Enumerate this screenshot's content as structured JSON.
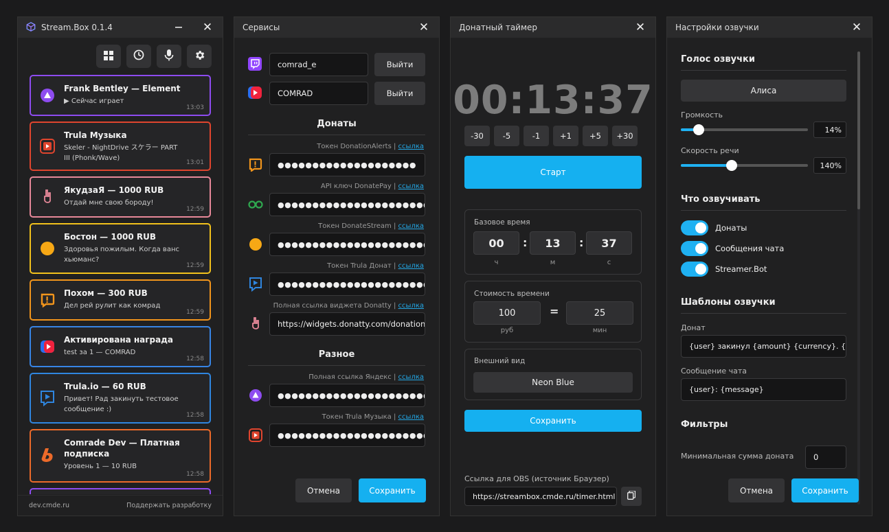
{
  "window1": {
    "title": "Stream.Box 0.1.4",
    "toolbar_icons": [
      "grid-icon",
      "clock-icon",
      "microphone-icon",
      "gear-icon"
    ],
    "cards": [
      {
        "title": "Frank Bentley — Element",
        "subtitle": "▶ Сейчас играет",
        "time": "13:03",
        "color": "#8e4cf0",
        "icon": "alice-icon"
      },
      {
        "title": "Trula Музыка",
        "subtitle": "Skeler - NightDrive スケラー PART III (Phonk/Wave)",
        "time": "13:01",
        "color": "#e0452e",
        "icon": "trula-music-icon"
      },
      {
        "title": "ЯкудзаЯ — 1000 RUB",
        "subtitle": "Отдай мне свою бороду!",
        "time": "12:59",
        "color": "#e8899a",
        "icon": "donatty-icon"
      },
      {
        "title": "Бостон — 1000 RUB",
        "subtitle": "Здоровья пожилым. Когда ванс хьюманс?",
        "time": "12:59",
        "color": "#f3c21c",
        "icon": "donatestream-icon"
      },
      {
        "title": "Похом — 300 RUB",
        "subtitle": "Дел рей рулит как комрад",
        "time": "12:59",
        "color": "#f2951c",
        "icon": "donationalerts-icon"
      },
      {
        "title": "Активирована награда",
        "subtitle": "test за 1 — COMRAD",
        "time": "12:58",
        "color": "#3785e6",
        "icon": "vk-play-icon"
      },
      {
        "title": "Trula.io — 60 RUB",
        "subtitle": "Привет! Рад закинуть тестовое сообщение :)",
        "time": "12:58",
        "color": "#2f86e0",
        "icon": "trula-icon"
      },
      {
        "title": "Comrade Dev — Платная подписка",
        "subtitle": "Уровень 1 — 10 RUB",
        "time": "12:58",
        "color": "#ec6a2a",
        "icon": "boosty-icon"
      }
    ],
    "footer_left": "dev.cmde.ru",
    "footer_right": "Поддержать разработку"
  },
  "window2": {
    "title": "Сервисы",
    "accounts": [
      {
        "icon": "twitch-icon",
        "value": "comrad_e",
        "button": "Выйти"
      },
      {
        "icon": "vk-play-icon",
        "value": "COMRAD",
        "button": "Выйти"
      }
    ],
    "donations_title": "Донаты",
    "tokens": [
      {
        "label": "Токен DonationAlerts",
        "link": "ссылка",
        "value": "●●●●●●●●●●●●●●●●●●●●",
        "icon": "donationalerts-icon"
      },
      {
        "label": "API ключ DonatePay",
        "link": "ссылка",
        "value": "●●●●●●●●●●●●●●●●●●●●●●●●●●●",
        "icon": "donatepay-icon"
      },
      {
        "label": "Токен DonateStream",
        "link": "ссылка",
        "value": "●●●●●●●●●●●●●●●●●●●●●●●●●●●",
        "icon": "donatestream-icon"
      },
      {
        "label": "Токен Trula Донат",
        "link": "ссылка",
        "value": "●●●●●●●●●●●●●●●●●●●●●●●●●●●",
        "icon": "trula-icon"
      },
      {
        "label": "Полная ссылка виджета Donatty",
        "link": "ссылка",
        "value": "https://widgets.donatty.com/donations",
        "icon": "donatty-icon"
      }
    ],
    "misc_title": "Разное",
    "misc_tokens": [
      {
        "label": "Полная ссылка Яндекс",
        "link": "ссылка",
        "value": "●●●●●●●●●●●●●●●●●●●●●●●●●●●",
        "icon": "alice-icon"
      },
      {
        "label": "Токен Trula Музыка",
        "link": "ссылка",
        "value": "●●●●●●●●●●●●●●●●●●●●●●●●●●●",
        "icon": "trula-music-icon"
      }
    ],
    "cancel": "Отмена",
    "save": "Сохранить"
  },
  "window3": {
    "title": "Донатный таймер",
    "timer": "00:13:37",
    "adjust": [
      "-30",
      "-5",
      "-1",
      "+1",
      "+5",
      "+30"
    ],
    "start": "Старт",
    "base_time_label": "Базовое время",
    "base_time": {
      "h": "00",
      "m": "13",
      "s": "37",
      "h_unit": "ч",
      "m_unit": "м",
      "s_unit": "с"
    },
    "cost_label": "Стоимость времени",
    "cost": {
      "rub": "100",
      "min": "25",
      "rub_unit": "руб",
      "min_unit": "мин",
      "eq": "="
    },
    "appearance_label": "Внешний вид",
    "appearance_value": "Neon Blue",
    "save": "Сохранить",
    "obs_label": "Ссылка для OBS (источник Браузер)",
    "obs_url": "https://streambox.cmde.ru/timer.html"
  },
  "window4": {
    "title": "Настройки озвучки",
    "voice_title": "Голос озвучки",
    "voice_value": "Алиса",
    "volume_label": "Громкость",
    "volume_value": "14%",
    "volume_level": 0.14,
    "speed_label": "Скорость речи",
    "speed_value": "140%",
    "speed_level": 0.4,
    "what_title": "Что озвучивать",
    "toggles": [
      {
        "label": "Донаты",
        "on": true
      },
      {
        "label": "Сообщения чата",
        "on": true
      },
      {
        "label": "Streamer.Bot",
        "on": true
      }
    ],
    "templates_title": "Шаблоны озвучки",
    "donation_label": "Донат",
    "donation_template": "{user} закинул {amount} {currency}. {message}",
    "chat_label": "Сообщение чата",
    "chat_template": "{user}: {message}",
    "filters_title": "Фильтры",
    "min_sum_label": "Минимальная сумма доната",
    "min_sum_value": "0",
    "cancel": "Отмена",
    "save": "Сохранить"
  }
}
